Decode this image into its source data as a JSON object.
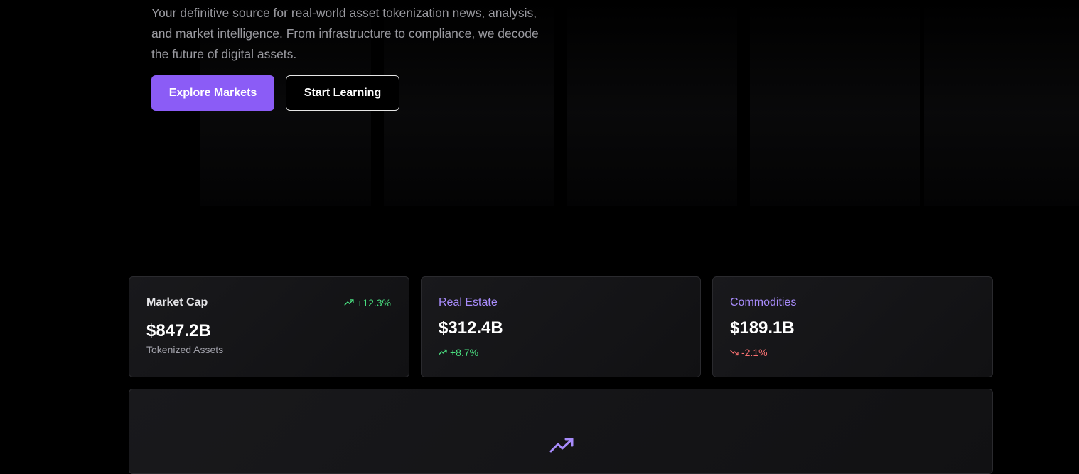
{
  "hero": {
    "description": "Your definitive source for real-world asset tokenization news, analysis, and market intelligence. From infrastructure to compliance, we decode the future of digital assets.",
    "primary_button": "Explore Markets",
    "secondary_button": "Start Learning"
  },
  "stats": [
    {
      "title": "Market Cap",
      "value": "$847.2B",
      "subtitle": "Tokenized Assets",
      "change": "+12.3%",
      "trend": "up",
      "icon": "trending-up-icon"
    },
    {
      "title": "Real Estate",
      "value": "$312.4B",
      "change": "+8.7%",
      "trend": "up",
      "icon": "trending-up-icon"
    },
    {
      "title": "Commodities",
      "value": "$189.1B",
      "change": "-2.1%",
      "trend": "down",
      "icon": "trending-down-icon"
    }
  ],
  "panel": {
    "icon": "trending-up-icon"
  },
  "colors": {
    "accent": "#8b5cf6",
    "accent_text": "#a78bfa",
    "positive": "#4ade80",
    "negative": "#f87171",
    "background": "#000000"
  }
}
